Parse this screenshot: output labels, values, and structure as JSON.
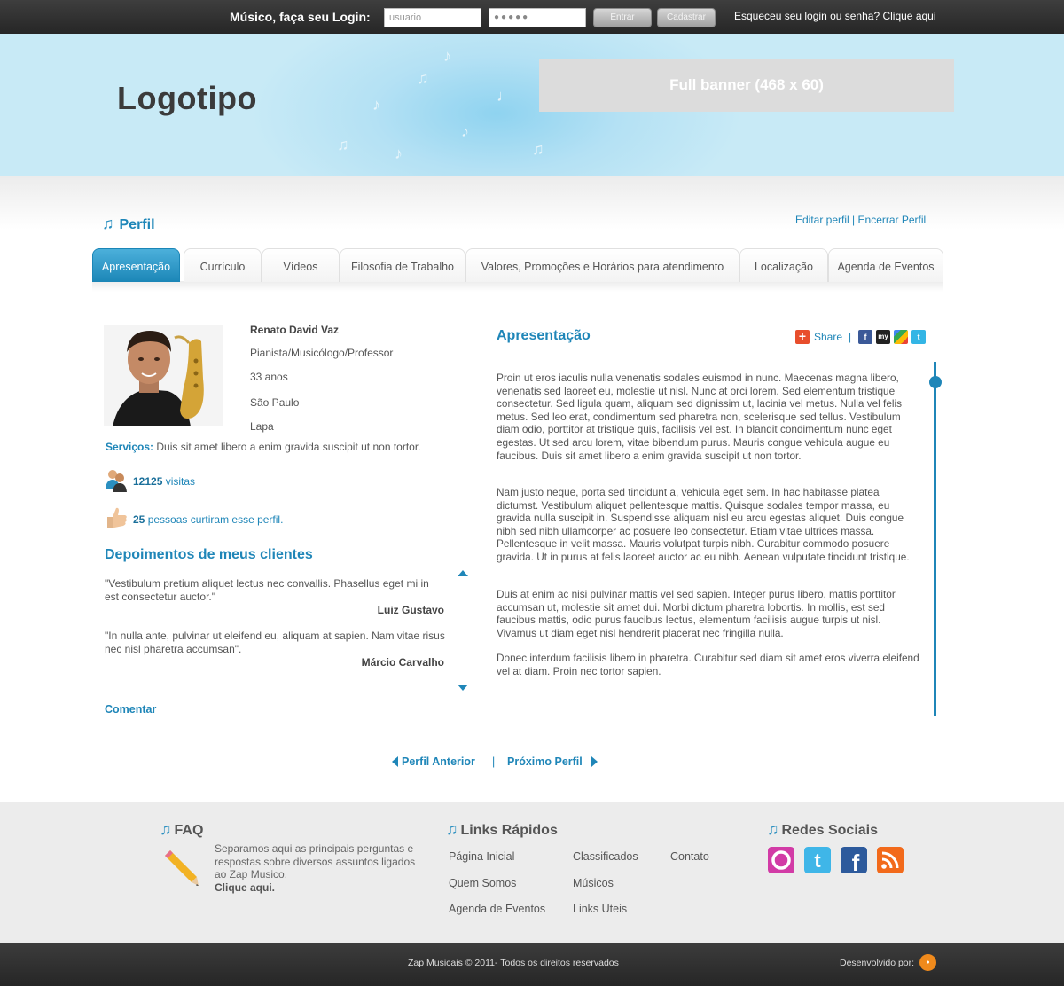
{
  "colors": {
    "accent": "#1f86b8",
    "header_bg": "#c8eaf6",
    "bar_dark": "#2e2e2e",
    "footer_bg": "#ececec"
  },
  "login": {
    "label": "Músico, faça seu Login:",
    "user_value": "usuario",
    "password_value": "●●●●●",
    "enter_label": "Entrar",
    "signup_label": "Cadastrar",
    "forgot_text": "Esqueceu seu login ou senha? Clique aqui"
  },
  "header": {
    "logo_text": "Logotipo",
    "banner_text": "Full banner (468 x 60)"
  },
  "profile": {
    "title": "Perfil",
    "edit_link": "Editar perfil",
    "separator": "|",
    "close_link": "Encerrar Perfil"
  },
  "tabs": [
    {
      "label": "Apresentação",
      "active": true
    },
    {
      "label": "Currículo"
    },
    {
      "label": "Vídeos"
    },
    {
      "label": "Filosofia de Trabalho"
    },
    {
      "label": "Valores, Promoções e Horários para atendimento"
    },
    {
      "label": "Localização"
    },
    {
      "label": "Agenda de Eventos"
    }
  ],
  "person": {
    "name": "Renato David Vaz",
    "role": "Pianista/Musicólogo/Professor",
    "age": "33 anos",
    "city": "São Paulo",
    "district": "Lapa",
    "services_label": "Serviços:",
    "services_text": "Duis sit amet libero a enim gravida suscipit ut non tortor."
  },
  "stats": {
    "visits_count": "12125",
    "visits_label": "visitas",
    "likes_count": "25",
    "likes_label": "pessoas curtiram esse perfil."
  },
  "testimonials": {
    "title": "Depoimentos de meus clientes",
    "items": [
      {
        "quote": "\"Vestibulum pretium aliquet lectus nec convallis. Phasellus eget mi in est consectetur auctor.\"",
        "author": "Luiz Gustavo"
      },
      {
        "quote": "\"In nulla ante, pulvinar ut eleifend eu, aliquam at sapien. Nam vitae risus nec nisl pharetra accumsan\".",
        "author": "Márcio Carvalho"
      }
    ],
    "comment_link": "Comentar"
  },
  "presentation": {
    "title": "Apresentação",
    "share_label": "Share",
    "share_separator": "|",
    "share_icons": [
      "facebook-icon",
      "myspace-icon",
      "google-icon",
      "twitter-icon"
    ],
    "paragraphs": [
      "Proin ut eros iaculis nulla venenatis sodales euismod in nunc. Maecenas magna libero, venenatis sed laoreet eu, molestie ut nisl. Nunc at orci lorem. Sed elementum tristique consectetur. Sed ligula quam, aliquam sed dignissim ut, lacinia vel metus. Nulla vel felis metus. Sed leo erat, condimentum sed pharetra non, scelerisque sed tellus. Vestibulum diam odio, porttitor at tristique quis, facilisis vel est. In blandit condimentum nunc eget egestas. Ut sed arcu lorem, vitae bibendum purus. Mauris congue vehicula augue eu faucibus. Duis sit amet libero a enim gravida suscipit ut non tortor.",
      "Nam justo neque, porta sed tincidunt a, vehicula eget sem. In hac habitasse platea dictumst. Vestibulum aliquet pellentesque mattis. Quisque sodales tempor massa, eu gravida nulla suscipit in. Suspendisse aliquam nisl eu arcu egestas aliquet. Duis congue nibh sed nibh ullamcorper ac posuere leo consectetur. Etiam vitae ultrices massa. Pellentesque in velit massa. Mauris volutpat turpis nibh. Curabitur commodo posuere gravida. Ut in purus at felis laoreet auctor ac eu nibh. Aenean vulputate tincidunt tristique.",
      "Duis at enim ac nisi pulvinar mattis vel sed sapien. Integer purus libero, mattis porttitor accumsan ut, molestie sit amet dui. Morbi dictum pharetra lobortis. In mollis, est sed faucibus mattis, odio purus faucibus lectus, elementum facilisis augue turpis ut nisl. Vivamus ut diam eget nisl hendrerit placerat nec fringilla nulla.",
      "Donec interdum facilisis libero in pharetra. Curabitur sed diam sit amet eros viverra eleifend vel at diam. Proin nec tortor sapien."
    ]
  },
  "pagination": {
    "prev_label": "Perfil Anterior",
    "separator": "|",
    "next_label": "Próximo Perfil"
  },
  "footer": {
    "faq_title": "FAQ",
    "faq_text": "Separamos aqui as principais perguntas e respostas sobre diversos assuntos ligados ao Zap Musico.",
    "faq_link": "Clique aqui.",
    "links_title": "Links Rápidos",
    "links": [
      "Página Inicial",
      "Classificados",
      "Contato",
      "Quem Somos",
      "Músicos",
      "Agenda de Eventos",
      "Links Uteis"
    ],
    "social_title": "Redes Sociais",
    "social_icons": [
      "orkut-icon",
      "twitter-icon",
      "facebook-icon",
      "rss-icon"
    ],
    "copyright": "Zap Musicais © 2011- Todos os direitos reservados",
    "developed_by": "Desenvolvido por:"
  }
}
